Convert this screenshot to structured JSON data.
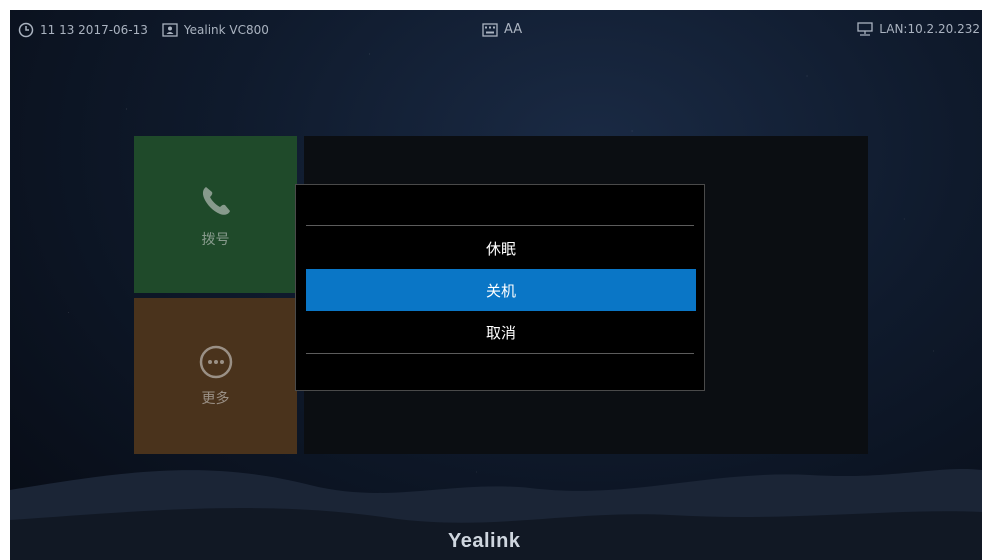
{
  "status_bar": {
    "time": "11 13 2017-06-13",
    "device_name": "Yealink VC800",
    "lan": "LAN:10.2.20.232",
    "icons": {
      "clock": "clock-icon",
      "device": "device-icon",
      "keyboard": "keyboard-icon",
      "font_size": "font-size-icon",
      "network": "network-icon"
    },
    "font_icon_text": "AA"
  },
  "tiles": {
    "dial": {
      "label": "拨号",
      "icon": "phone-icon",
      "color": "#1f4a2a"
    },
    "more": {
      "label": "更多",
      "icon": "more-icon",
      "color": "#4a331c"
    }
  },
  "dialog": {
    "items": [
      {
        "label": "休眠",
        "selected": false
      },
      {
        "label": "关机",
        "selected": true
      },
      {
        "label": "取消",
        "selected": false
      }
    ],
    "accent": "#0a76c6"
  },
  "brand": "Yealink"
}
